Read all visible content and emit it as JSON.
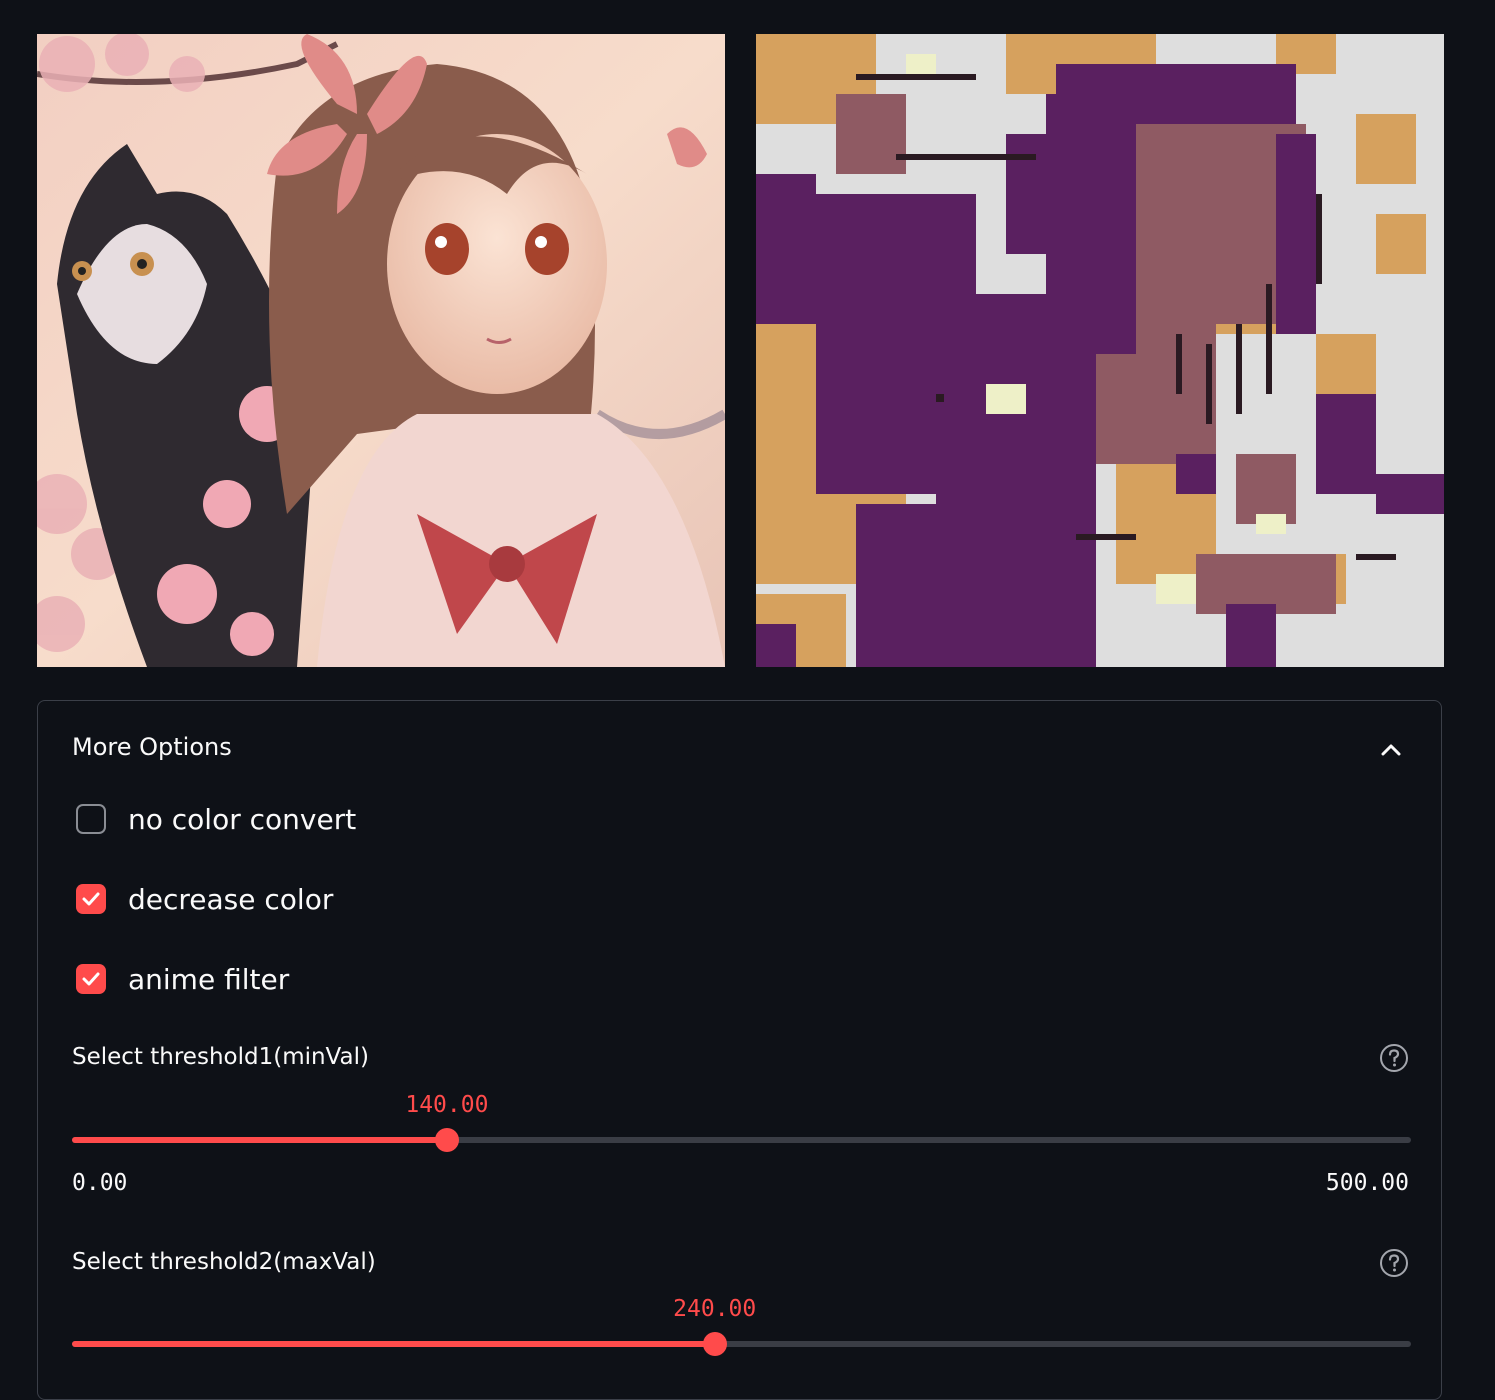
{
  "images": {
    "original": {
      "description_icon": "anime-girl-cat-image"
    },
    "converted": {
      "description_icon": "pixelated-converted-image"
    }
  },
  "expander": {
    "title": "More Options",
    "expanded": true
  },
  "checkboxes": [
    {
      "label": "no color convert",
      "checked": false
    },
    {
      "label": "decrease color",
      "checked": true
    },
    {
      "label": "anime filter",
      "checked": true
    }
  ],
  "sliders": [
    {
      "label": "Select threshold1(minVal)",
      "value": "140.00",
      "min": "0.00",
      "max": "500.00",
      "fraction": 0.28
    },
    {
      "label": "Select threshold2(maxVal)",
      "value": "240.00",
      "min": "0.00",
      "max": "500.00",
      "fraction": 0.48
    }
  ],
  "colors": {
    "accent": "#ff4b4b",
    "background": "#0e1117",
    "track": "#3a3d45"
  }
}
